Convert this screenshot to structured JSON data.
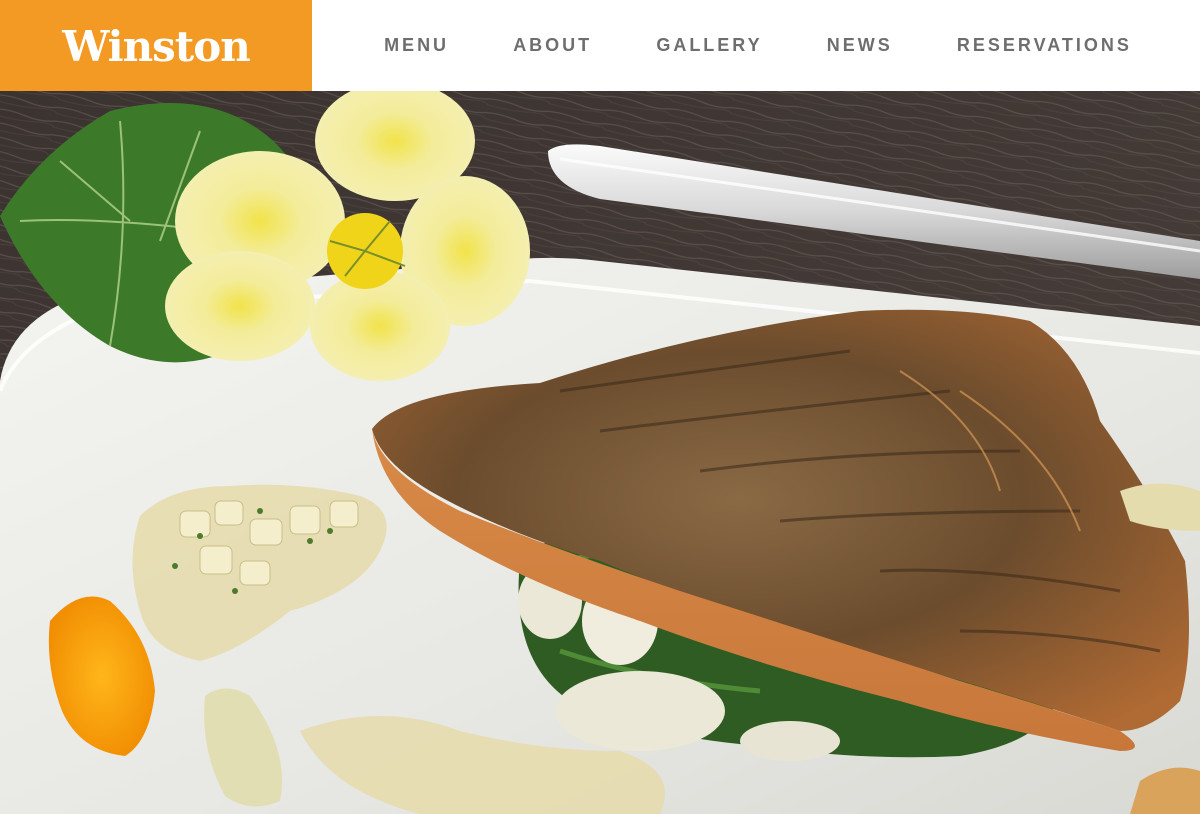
{
  "brand": {
    "name": "Winston",
    "bg_color": "#f39a25",
    "text_color": "#ffffff"
  },
  "nav": {
    "items": [
      {
        "id": "menu",
        "label": "MENU"
      },
      {
        "id": "about",
        "label": "ABOUT"
      },
      {
        "id": "gallery",
        "label": "GALLERY"
      },
      {
        "id": "news",
        "label": "NEWS"
      },
      {
        "id": "reservations",
        "label": "RESERVATIONS"
      }
    ],
    "text_color": "#6e6e6e"
  },
  "hero": {
    "icon": "plated-fish-dish-photo"
  }
}
